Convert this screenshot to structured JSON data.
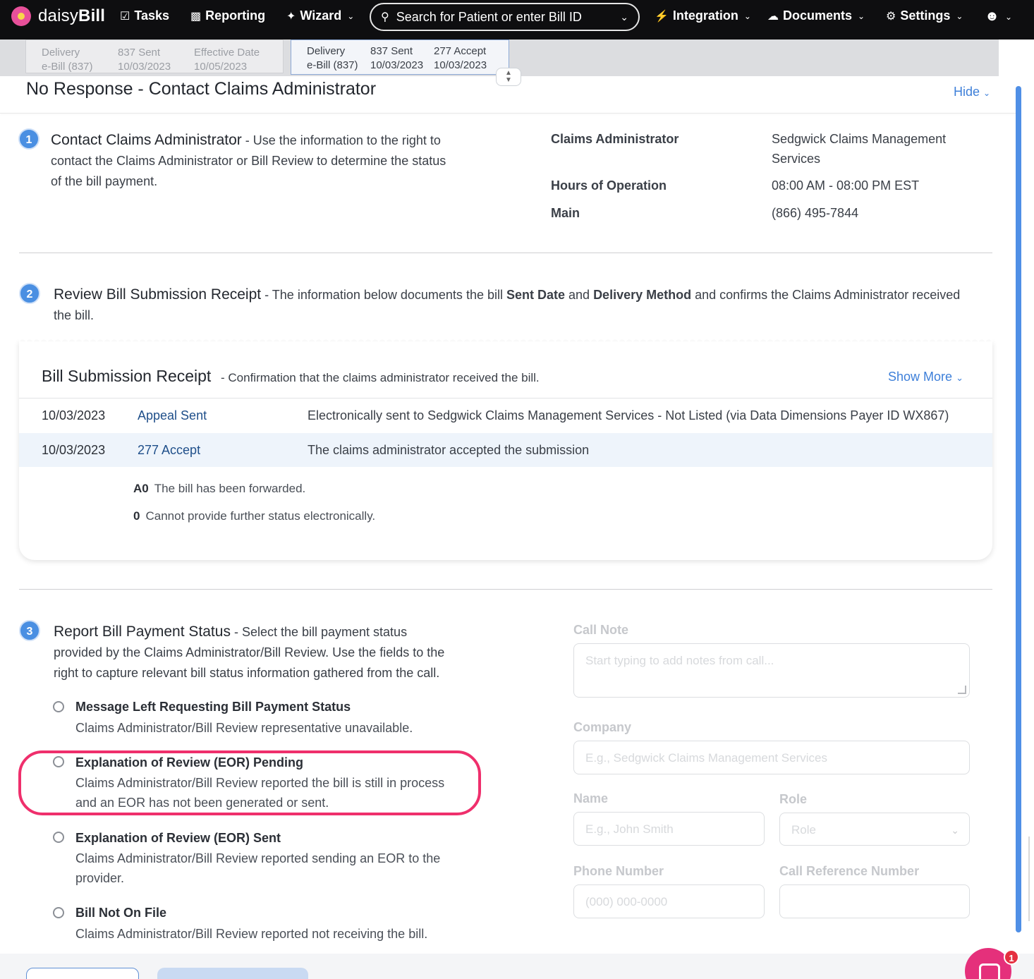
{
  "nav": {
    "logo_prefix": "daisy",
    "logo_suffix": "Bill",
    "tasks": "Tasks",
    "reporting": "Reporting",
    "wizard": "Wizard",
    "search_placeholder": "Search for Patient or enter Bill ID",
    "integration": "Integration",
    "documents": "Documents",
    "settings": "Settings"
  },
  "tabs": {
    "inactive": {
      "delivery_label": "Delivery",
      "delivery_value": "e-Bill (837)",
      "sent_label": "837 Sent",
      "sent_value": "10/03/2023",
      "effective_label": "Effective Date",
      "effective_value": "10/05/2023"
    },
    "active": {
      "delivery_label": "Delivery",
      "delivery_value": "e-Bill (837)",
      "sent_label": "837 Sent",
      "sent_value": "10/03/2023",
      "accept_label": "277 Accept",
      "accept_value": "10/03/2023"
    }
  },
  "header": {
    "title": "No Response - Contact Claims Administrator",
    "hide": "Hide"
  },
  "step1": {
    "number": "1",
    "title": "Contact Claims Administrator",
    "line1": " - Use the information to the right to",
    "line2": "contact the Claims Administrator or Bill Review to determine the status",
    "line3": "of the bill payment.",
    "claims_admin_label": "Claims Administrator",
    "claims_admin_value1": "Sedgwick Claims Management",
    "claims_admin_value2": "Services",
    "hours_label": "Hours of Operation",
    "hours_value": "08:00 AM - 08:00 PM EST",
    "main_label": "Main",
    "main_value": "(866) 495-7844"
  },
  "step2": {
    "number": "2",
    "title": "Review Bill Submission Receipt",
    "text_a": " - The information below documents the bill ",
    "bold_a": "Sent Date",
    "text_b": " and ",
    "bold_b": "Delivery Method",
    "text_c": " and confirms the Claims Administrator received",
    "line2": "the bill."
  },
  "receipt": {
    "title": "Bill Submission Receipt",
    "subtitle": " - Confirmation that the claims administrator received the bill.",
    "show_more": "Show More",
    "rows": [
      {
        "date": "10/03/2023",
        "type": "Appeal Sent",
        "desc": "Electronically sent to Sedgwick Claims Management Services - Not Listed (via Data Dimensions Payer ID WX867)"
      },
      {
        "date": "10/03/2023",
        "type": "277 Accept",
        "desc": "The claims administrator accepted the submission"
      }
    ],
    "codes": [
      {
        "code": "A0",
        "text": "The bill has been forwarded."
      },
      {
        "code": "0",
        "text": "Cannot provide further status electronically."
      }
    ]
  },
  "step3": {
    "number": "3",
    "title": "Report Bill Payment Status",
    "line1": " - Select the bill payment status",
    "line2": "provided by the Claims Administrator/Bill Review. Use the fields to the",
    "line3": "right to capture relevant bill status information gathered from the call.",
    "options": [
      {
        "title": "Message Left Requesting Bill Payment Status",
        "desc1": "Claims Administrator/Bill Review representative unavailable.",
        "desc2": ""
      },
      {
        "title": "Explanation of Review (EOR) Pending",
        "desc1": "Claims Administrator/Bill Review reported the bill is still in process",
        "desc2": "and an EOR has not been generated or sent."
      },
      {
        "title": "Explanation of Review (EOR) Sent",
        "desc1": "Claims Administrator/Bill Review reported sending an EOR to the",
        "desc2": "provider."
      },
      {
        "title": "Bill Not On File",
        "desc1": "Claims Administrator/Bill Review reported not receiving the bill.",
        "desc2": ""
      }
    ]
  },
  "form": {
    "call_note_label": "Call Note",
    "call_note_placeholder": "Start typing to add notes from call...",
    "company_label": "Company",
    "company_placeholder": "E.g., Sedgwick Claims Management Services",
    "name_label": "Name",
    "name_placeholder": "E.g., John Smith",
    "role_label": "Role",
    "role_placeholder": "Role",
    "phone_label": "Phone Number",
    "phone_placeholder": "(000) 000-0000",
    "ref_label": "Call Reference Number",
    "ref_placeholder": ""
  },
  "chat": {
    "badge": "1"
  },
  "colors": {
    "accent": "#4a8fe2",
    "highlight": "#ef2f6c",
    "nav_bg": "#0e0e10"
  }
}
